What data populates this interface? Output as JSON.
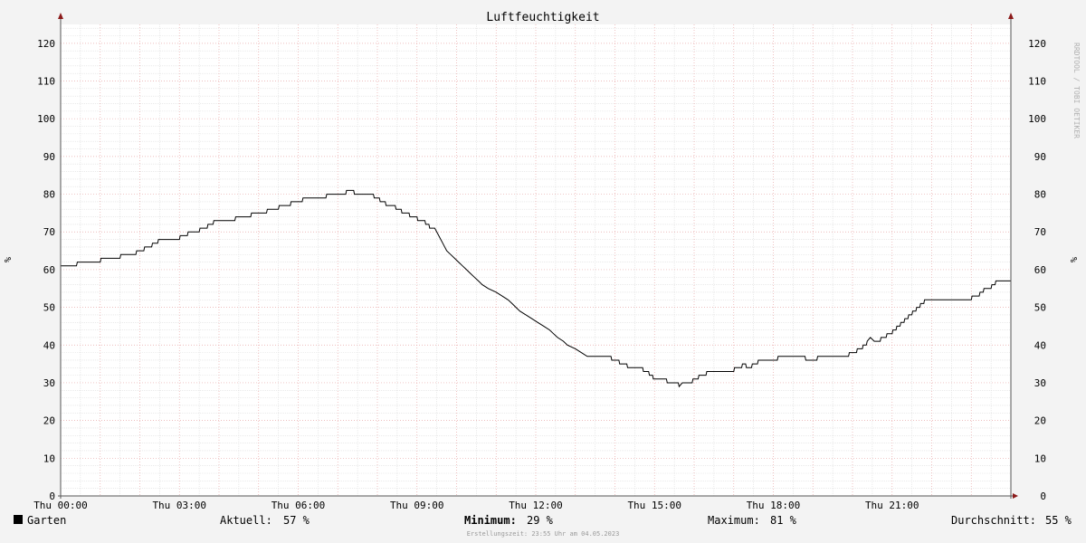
{
  "chart_data": {
    "type": "line",
    "title": "Luftfeuchtigkeit",
    "ylabel": "%",
    "ylim": [
      0,
      125
    ],
    "yticks": [
      0,
      10,
      20,
      30,
      40,
      50,
      60,
      70,
      80,
      90,
      100,
      110,
      120
    ],
    "xlim": [
      0,
      24
    ],
    "xticks": [
      {
        "hour": 0,
        "label": "Thu 00:00"
      },
      {
        "hour": 3,
        "label": "Thu 03:00"
      },
      {
        "hour": 6,
        "label": "Thu 06:00"
      },
      {
        "hour": 9,
        "label": "Thu 09:00"
      },
      {
        "hour": 12,
        "label": "Thu 12:00"
      },
      {
        "hour": 15,
        "label": "Thu 15:00"
      },
      {
        "hour": 18,
        "label": "Thu 18:00"
      },
      {
        "hour": 21,
        "label": "Thu 21:00"
      }
    ],
    "grid": true,
    "series": [
      {
        "name": "Garten",
        "color": "#000000",
        "points": [
          [
            0.0,
            61
          ],
          [
            0.4,
            61
          ],
          [
            0.42,
            62
          ],
          [
            1.0,
            62
          ],
          [
            1.02,
            63
          ],
          [
            1.5,
            63
          ],
          [
            1.52,
            64
          ],
          [
            1.9,
            64
          ],
          [
            1.92,
            65
          ],
          [
            2.1,
            65
          ],
          [
            2.12,
            66
          ],
          [
            2.3,
            66
          ],
          [
            2.32,
            67
          ],
          [
            2.45,
            67
          ],
          [
            2.47,
            68
          ],
          [
            3.0,
            68
          ],
          [
            3.02,
            69
          ],
          [
            3.2,
            69
          ],
          [
            3.22,
            70
          ],
          [
            3.5,
            70
          ],
          [
            3.52,
            71
          ],
          [
            3.7,
            71
          ],
          [
            3.72,
            72
          ],
          [
            3.85,
            72
          ],
          [
            3.87,
            73
          ],
          [
            4.4,
            73
          ],
          [
            4.42,
            74
          ],
          [
            4.8,
            74
          ],
          [
            4.82,
            75
          ],
          [
            5.2,
            75
          ],
          [
            5.22,
            76
          ],
          [
            5.5,
            76
          ],
          [
            5.52,
            77
          ],
          [
            5.8,
            77
          ],
          [
            5.82,
            78
          ],
          [
            6.1,
            78
          ],
          [
            6.12,
            79
          ],
          [
            6.7,
            79
          ],
          [
            6.72,
            80
          ],
          [
            7.2,
            80
          ],
          [
            7.22,
            81
          ],
          [
            7.4,
            81
          ],
          [
            7.42,
            80
          ],
          [
            7.9,
            80
          ],
          [
            7.92,
            79
          ],
          [
            8.05,
            79
          ],
          [
            8.07,
            78
          ],
          [
            8.2,
            78
          ],
          [
            8.22,
            77
          ],
          [
            8.45,
            77
          ],
          [
            8.47,
            76
          ],
          [
            8.6,
            76
          ],
          [
            8.62,
            75
          ],
          [
            8.8,
            75
          ],
          [
            8.82,
            74
          ],
          [
            9.0,
            74
          ],
          [
            9.02,
            73
          ],
          [
            9.2,
            73
          ],
          [
            9.22,
            72
          ],
          [
            9.3,
            72
          ],
          [
            9.32,
            71
          ],
          [
            9.45,
            71
          ],
          [
            9.55,
            69
          ],
          [
            9.65,
            67
          ],
          [
            9.75,
            65
          ],
          [
            9.85,
            64
          ],
          [
            9.95,
            63
          ],
          [
            10.05,
            62
          ],
          [
            10.15,
            61
          ],
          [
            10.25,
            60
          ],
          [
            10.35,
            59
          ],
          [
            10.45,
            58
          ],
          [
            10.55,
            57
          ],
          [
            10.65,
            56
          ],
          [
            10.8,
            55
          ],
          [
            11.0,
            54
          ],
          [
            11.15,
            53
          ],
          [
            11.3,
            52
          ],
          [
            11.4,
            51
          ],
          [
            11.5,
            50
          ],
          [
            11.6,
            49
          ],
          [
            11.75,
            48
          ],
          [
            11.9,
            47
          ],
          [
            12.05,
            46
          ],
          [
            12.2,
            45
          ],
          [
            12.35,
            44
          ],
          [
            12.45,
            43
          ],
          [
            12.55,
            42
          ],
          [
            12.7,
            41
          ],
          [
            12.8,
            40
          ],
          [
            13.0,
            39
          ],
          [
            13.15,
            38
          ],
          [
            13.3,
            37
          ],
          [
            13.9,
            37
          ],
          [
            13.92,
            36
          ],
          [
            14.1,
            36
          ],
          [
            14.12,
            35
          ],
          [
            14.3,
            35
          ],
          [
            14.32,
            34
          ],
          [
            14.7,
            34
          ],
          [
            14.72,
            33
          ],
          [
            14.85,
            33
          ],
          [
            14.87,
            32
          ],
          [
            14.95,
            32
          ],
          [
            14.97,
            31
          ],
          [
            15.3,
            31
          ],
          [
            15.32,
            30
          ],
          [
            15.6,
            30
          ],
          [
            15.62,
            29
          ],
          [
            15.7,
            30
          ],
          [
            15.95,
            30
          ],
          [
            15.97,
            31
          ],
          [
            16.1,
            31
          ],
          [
            16.12,
            32
          ],
          [
            16.3,
            32
          ],
          [
            16.32,
            33
          ],
          [
            17.0,
            33
          ],
          [
            17.02,
            34
          ],
          [
            17.2,
            34
          ],
          [
            17.22,
            35
          ],
          [
            17.3,
            35
          ],
          [
            17.32,
            34
          ],
          [
            17.45,
            34
          ],
          [
            17.47,
            35
          ],
          [
            17.6,
            35
          ],
          [
            17.62,
            36
          ],
          [
            18.1,
            36
          ],
          [
            18.12,
            37
          ],
          [
            18.8,
            37
          ],
          [
            18.82,
            36
          ],
          [
            19.1,
            36
          ],
          [
            19.12,
            37
          ],
          [
            19.9,
            37
          ],
          [
            19.92,
            38
          ],
          [
            20.1,
            38
          ],
          [
            20.12,
            39
          ],
          [
            20.25,
            39
          ],
          [
            20.27,
            40
          ],
          [
            20.35,
            40
          ],
          [
            20.37,
            41
          ],
          [
            20.45,
            42
          ],
          [
            20.55,
            41
          ],
          [
            20.7,
            41
          ],
          [
            20.72,
            42
          ],
          [
            20.85,
            42
          ],
          [
            20.87,
            43
          ],
          [
            21.0,
            43
          ],
          [
            21.02,
            44
          ],
          [
            21.1,
            44
          ],
          [
            21.12,
            45
          ],
          [
            21.2,
            45
          ],
          [
            21.22,
            46
          ],
          [
            21.3,
            46
          ],
          [
            21.32,
            47
          ],
          [
            21.4,
            47
          ],
          [
            21.42,
            48
          ],
          [
            21.5,
            48
          ],
          [
            21.52,
            49
          ],
          [
            21.6,
            49
          ],
          [
            21.62,
            50
          ],
          [
            21.7,
            50
          ],
          [
            21.72,
            51
          ],
          [
            21.8,
            51
          ],
          [
            21.82,
            52
          ],
          [
            23.0,
            52
          ],
          [
            23.02,
            53
          ],
          [
            23.2,
            53
          ],
          [
            23.22,
            54
          ],
          [
            23.3,
            54
          ],
          [
            23.32,
            55
          ],
          [
            23.5,
            55
          ],
          [
            23.52,
            56
          ],
          [
            23.6,
            56
          ],
          [
            23.62,
            57
          ],
          [
            24.0,
            57
          ]
        ]
      }
    ]
  },
  "watermark": "RRDTOOL / TOBI OETIKER",
  "legend": {
    "series_name": "Garten",
    "current_label": "Aktuell:",
    "current_value": "57 %",
    "min_label": "Minimum:",
    "min_value": "29 %",
    "max_label": "Maximum:",
    "max_value": "81 %",
    "avg_label": "Durchschnitt:",
    "avg_value": "55 %"
  },
  "footer": "Erstellungszeit: 23:55 Uhr am 04.05.2023"
}
